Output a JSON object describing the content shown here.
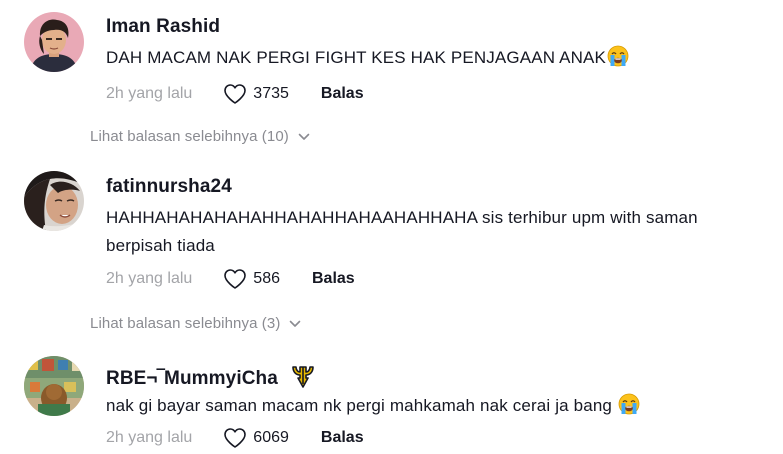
{
  "comments": [
    {
      "username": "Iman Rashid",
      "text": "DAH MACAM NAK PERGI FIGHT KES HAK PENJAGAAN ANAK",
      "time": "2h yang lalu",
      "likes": "3735",
      "reply_label": "Balas",
      "view_replies": "Lihat balasan selebihnya (10)",
      "emoji_icon": "loudly-crying-face-icon"
    },
    {
      "username": "fatinnursha24",
      "text": "HAHHAHAHAHAHAHHAHAHHAHAAHAHHAHA sis terhibur upm with saman berpisah tiada",
      "time": "2h yang lalu",
      "likes": "586",
      "reply_label": "Balas",
      "view_replies": "Lihat balasan selebihnya (3)"
    },
    {
      "username": "RBE¬‾MummyiCha",
      "text": "nak gi bayar saman macam nk pergi mahkamah nak cerai ja bang",
      "time": "2h yang lalu",
      "likes": "6069",
      "reply_label": "Balas",
      "badge_icon": "trident-icon",
      "emoji_icon": "loudly-crying-face-icon"
    }
  ],
  "colors": {
    "text_primary": "#161823",
    "text_secondary": "#8a8b91",
    "background": "#ffffff"
  }
}
